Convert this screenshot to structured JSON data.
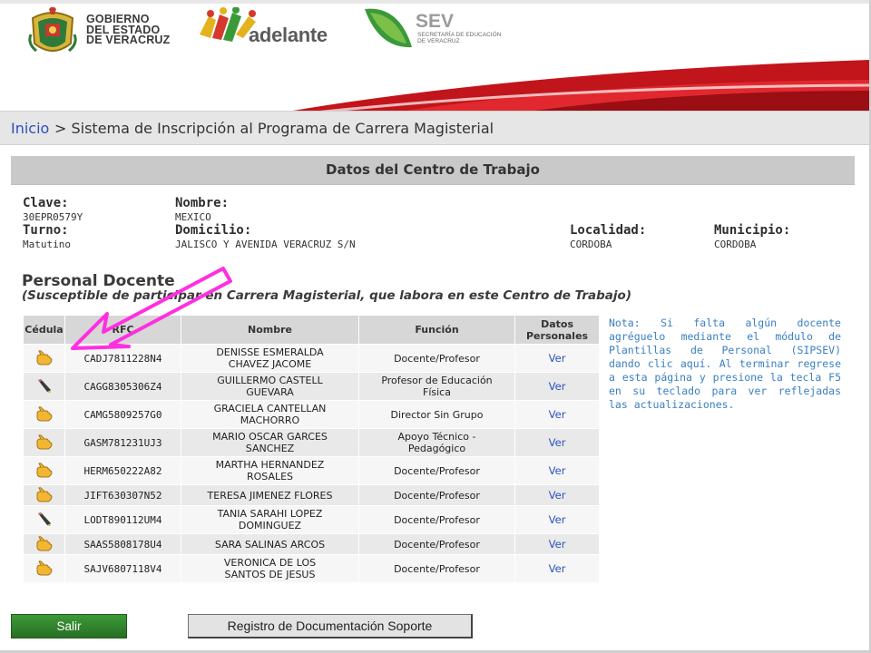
{
  "header": {
    "gov_logo_icon": "veracruz-coat-of-arms-icon",
    "gov_text_lines": [
      "GOBIERNO",
      "DEL ESTADO",
      "DE VERACRUZ"
    ],
    "adelante_text": "adelante",
    "sev_title": "SEV",
    "sev_subtitle_lines": [
      "SECRETARÍA DE EDUCACIÓN",
      "DE VERACRUZ"
    ]
  },
  "breadcrumb": {
    "home": "Inicio",
    "rest": " > Sistema de Inscripción al Programa de Carrera Magisterial"
  },
  "section_title": "Datos del Centro de Trabajo",
  "centro": {
    "clave_label": "Clave:",
    "clave": "30EPR0579Y",
    "nombre_label": "Nombre:",
    "nombre": "MEXICO",
    "turno_label": "Turno:",
    "turno": "Matutino",
    "domicilio_label": "Domicilio:",
    "domicilio": "JALISCO Y AVENIDA VERACRUZ S/N",
    "localidad_label": "Localidad:",
    "localidad": "CORDOBA",
    "municipio_label": "Municipio:",
    "municipio": "CORDOBA"
  },
  "personal": {
    "title": "Personal Docente",
    "subtitle": "(Susceptible de participar en Carrera Magisterial, que labora en este Centro de Trabajo)"
  },
  "table": {
    "headers": [
      "Cédula",
      "RFC",
      "Nombre",
      "Función",
      "Datos Personales"
    ],
    "rows": [
      {
        "icon": "hand-point-icon",
        "rfc": "CADJ7811228N4",
        "nombre_1": "DENISSE ESMERALDA",
        "nombre_2": "CHAVEZ JACOME",
        "funcion_1": "Docente/Profesor",
        "funcion_2": "",
        "link": "Ver"
      },
      {
        "icon": "pencil-icon",
        "rfc": "CAGG8305306Z4",
        "nombre_1": "GUILLERMO CASTELL",
        "nombre_2": "GUEVARA",
        "funcion_1": "Profesor de Educación",
        "funcion_2": "Física",
        "link": "Ver"
      },
      {
        "icon": "hand-point-icon",
        "rfc": "CAMG5809257G0",
        "nombre_1": "GRACIELA CANTELLAN",
        "nombre_2": "MACHORRO",
        "funcion_1": "Director Sin Grupo",
        "funcion_2": "",
        "link": "Ver"
      },
      {
        "icon": "hand-point-icon",
        "rfc": "GASM781231UJ3",
        "nombre_1": "MARIO OSCAR GARCES",
        "nombre_2": "SANCHEZ",
        "funcion_1": "Apoyo Técnico -",
        "funcion_2": "Pedagógico",
        "link": "Ver"
      },
      {
        "icon": "hand-point-icon",
        "rfc": "HERM650222A82",
        "nombre_1": "MARTHA HERNANDEZ",
        "nombre_2": "ROSALES",
        "funcion_1": "Docente/Profesor",
        "funcion_2": "",
        "link": "Ver"
      },
      {
        "icon": "hand-point-icon",
        "rfc": "JIFT630307N52",
        "nombre_1": "TERESA JIMENEZ FLORES",
        "nombre_2": "",
        "funcion_1": "Docente/Profesor",
        "funcion_2": "",
        "link": "Ver"
      },
      {
        "icon": "pencil-icon",
        "rfc": "LODT890112UM4",
        "nombre_1": "TANIA SARAHI LOPEZ",
        "nombre_2": "DOMINGUEZ",
        "funcion_1": "Docente/Profesor",
        "funcion_2": "",
        "link": "Ver"
      },
      {
        "icon": "hand-point-icon",
        "rfc": "SAAS5808178U4",
        "nombre_1": "SARA SALINAS ARCOS",
        "nombre_2": "",
        "funcion_1": "Docente/Profesor",
        "funcion_2": "",
        "link": "Ver"
      },
      {
        "icon": "hand-point-icon",
        "rfc": "SAJV6807118V4",
        "nombre_1": "VERONICA DE LOS",
        "nombre_2": "SANTOS DE JESUS",
        "funcion_1": "Docente/Profesor",
        "funcion_2": "",
        "link": "Ver"
      }
    ]
  },
  "note": "Nota: Si falta algún docente agréguelo mediante el módulo de Plantillas de Personal (SIPSEV) dando clic aquí. Al terminar regrese a esta página y presione la tecla F5 en su teclado para ver reflejadas las actualizaciones.",
  "buttons": {
    "salir": "Salir",
    "registro": "Registro de Documentación Soporte"
  },
  "colors": {
    "link_blue": "#2a52be",
    "note_blue": "#3a7fc1",
    "header_gray": "#c9c9c9",
    "salir_green": "#2f8a2b",
    "annotation_magenta": "#ff2fe0"
  }
}
